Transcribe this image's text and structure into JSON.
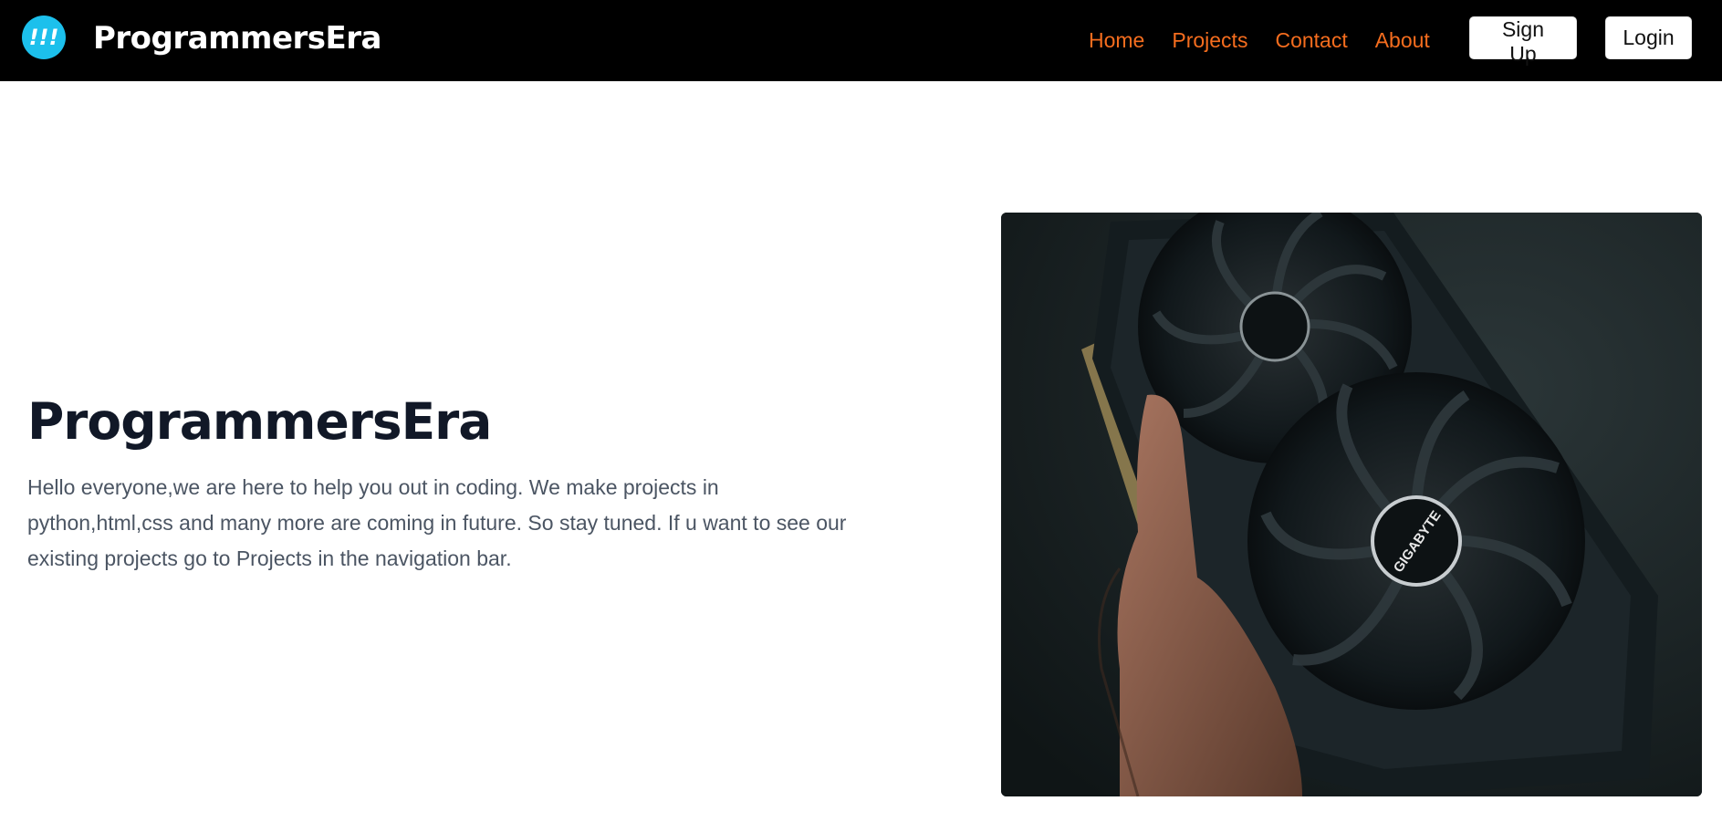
{
  "navbar": {
    "brand": "ProgrammersEra",
    "logo_text": "!!!",
    "links": [
      "Home",
      "Projects",
      "Contact",
      "About"
    ],
    "signup_label": "Sign Up",
    "login_label": "Login"
  },
  "hero": {
    "title": "ProgrammersEra",
    "description": "Hello everyone,we are here to help you out in coding. We make projects in python,html,css and many more are coming in future. So stay tuned. If u want to see our existing projects go to Projects in the navigation bar.",
    "image_label": "GIGABYTE"
  },
  "colors": {
    "navbar_bg": "#000000",
    "link": "#f56d1e",
    "logo": "#1cc0ec"
  }
}
